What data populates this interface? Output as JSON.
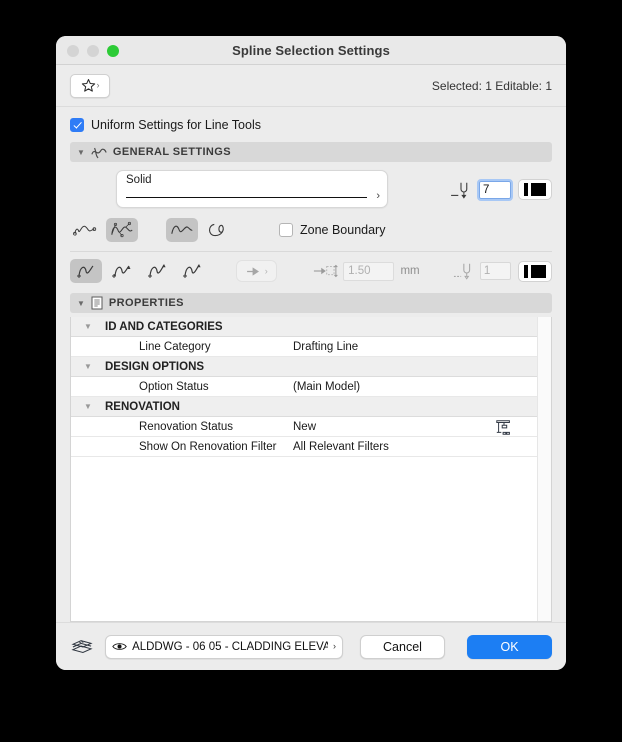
{
  "window": {
    "title": "Spline Selection Settings",
    "traffic_lights": [
      "close-button",
      "minimize-button",
      "zoom-button"
    ],
    "accent_blue": "#1c7ef3",
    "zoom_green": "#2ccb36"
  },
  "toolbar": {
    "favorites_icon": "star-icon",
    "favorites_chevron": "›",
    "selection_info": "Selected: 1 Editable: 1"
  },
  "uniform": {
    "label": "Uniform Settings for Line Tools",
    "checked": true
  },
  "general_settings": {
    "header": "GENERAL SETTINGS",
    "header_icon": "spline-icon",
    "disclosure": "▼",
    "line_type": {
      "name": "Solid",
      "chevron": "›"
    },
    "pen": {
      "value": "7",
      "icon": "pen-tip-icon",
      "swatch_name": "pen-color-swatch"
    },
    "spline_type_buttons": [
      {
        "name": "spline-natural-icon",
        "selected": false
      },
      {
        "name": "spline-bezier-icon",
        "selected": true
      }
    ],
    "curve_buttons": [
      {
        "name": "spline-open-icon",
        "selected": true
      },
      {
        "name": "spline-closed-icon",
        "selected": false
      }
    ],
    "zone_boundary": {
      "label": "Zone Boundary",
      "checked": false
    },
    "endpoint_buttons": [
      {
        "name": "line-end-plain-icon",
        "selected": true
      },
      {
        "name": "line-end-start-arrow-icon",
        "selected": false
      },
      {
        "name": "line-end-end-arrow-icon",
        "selected": false
      },
      {
        "name": "line-end-both-arrow-icon",
        "selected": false
      }
    ],
    "arrow_style_button": {
      "name": "arrowhead-style-button",
      "icon": "arrowhead-icon",
      "chevron": "›",
      "enabled": false
    },
    "arrow_size": {
      "icon": "arrow-size-icon",
      "value": "1.50",
      "unit": "mm",
      "enabled": false
    },
    "arrow_pen": {
      "icon": "pen-tip-dashed-icon",
      "value": "1",
      "swatch_name": "arrow-pen-color-swatch",
      "enabled": false
    }
  },
  "properties": {
    "header": "PROPERTIES",
    "header_icon": "document-icon",
    "disclosure": "▼",
    "groups": [
      {
        "name": "ID AND CATEGORIES",
        "disclosure": "▼",
        "rows": [
          {
            "label": "Line Category",
            "value": "Drafting Line",
            "icon": null
          }
        ]
      },
      {
        "name": "DESIGN OPTIONS",
        "disclosure": "▼",
        "rows": [
          {
            "label": "Option Status",
            "value": "(Main Model)",
            "icon": null
          }
        ]
      },
      {
        "name": "RENOVATION",
        "disclosure": "▼",
        "rows": [
          {
            "label": "Renovation Status",
            "value": "New",
            "icon": "crane-new-construction-icon"
          },
          {
            "label": "Show On Renovation Filter",
            "value": "All Relevant Filters",
            "icon": null
          }
        ]
      }
    ]
  },
  "footer": {
    "layers_icon": "layers-stack-icon",
    "layer": {
      "eye_icon": "eye-icon",
      "text": "ALDDWG - 06 05 - CLADDING ELEVA...",
      "chevron": "›"
    },
    "cancel_label": "Cancel",
    "ok_label": "OK"
  }
}
